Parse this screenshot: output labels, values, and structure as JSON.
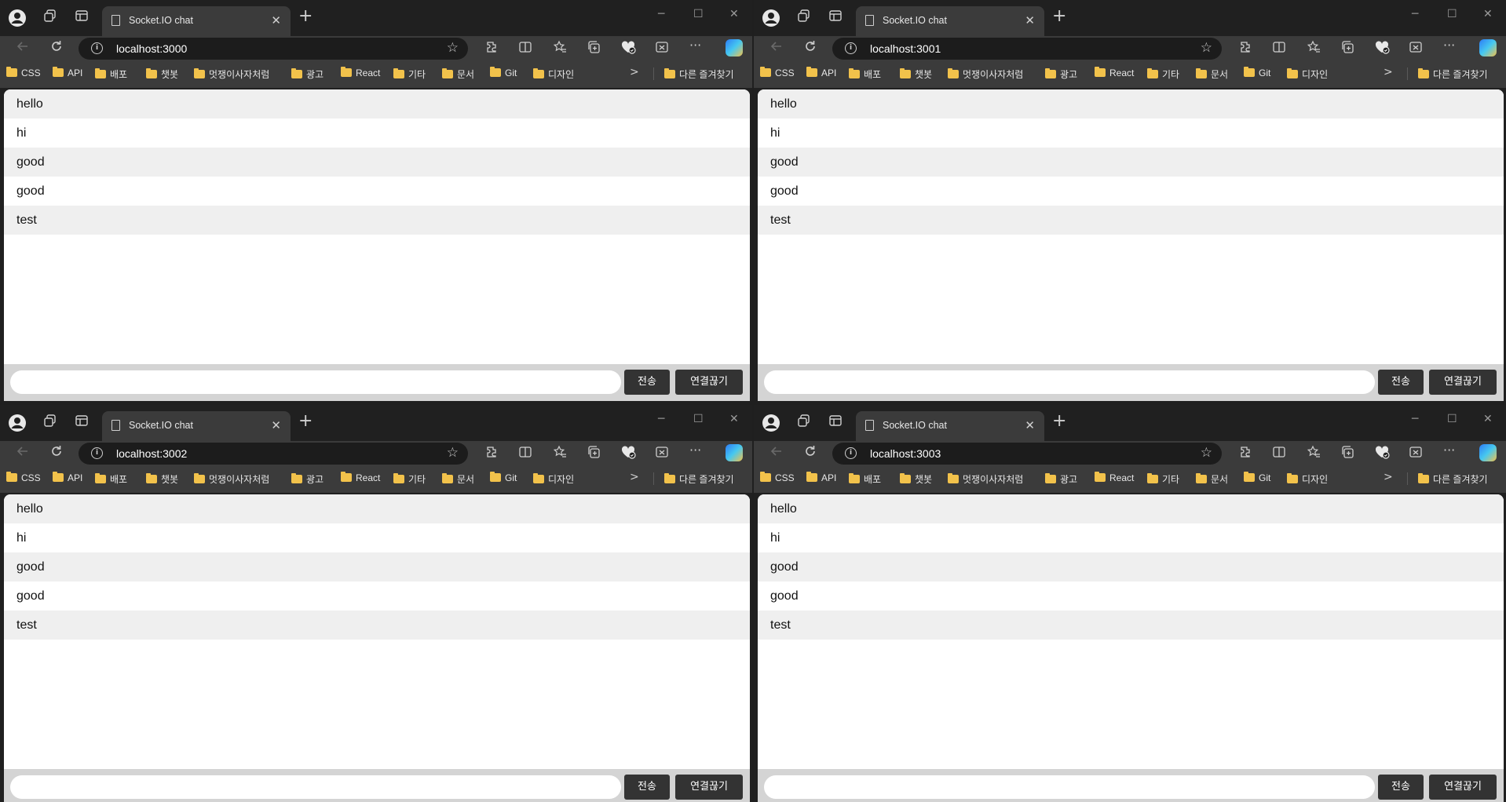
{
  "browser": {
    "tab_title": "Socket.IO chat",
    "new_tab_glyph": "+",
    "close_glyph": "✕",
    "minimize_glyph": "─",
    "maximize_glyph": "☐",
    "bookmarks": [
      "CSS",
      "API",
      "배포",
      "챗봇",
      "멋쟁이사자처럼",
      "광고",
      "React",
      "기타",
      "문서",
      "Git",
      "디자인"
    ],
    "other_favorites": "다른 즐겨찾기"
  },
  "windows": [
    {
      "url": "localhost:3000"
    },
    {
      "url": "localhost:3001"
    },
    {
      "url": "localhost:3002"
    },
    {
      "url": "localhost:3003"
    }
  ],
  "chat": {
    "messages": [
      "hello",
      "hi",
      "good",
      "good",
      "test"
    ],
    "input_value": "",
    "send_label": "전송",
    "disconnect_label": "연결끊기"
  },
  "icons": {
    "back": "back-arrow-icon",
    "refresh": "refresh-icon",
    "info": "site-info-icon",
    "favorite": "favorite-star-icon",
    "extensions": "extensions-icon",
    "split": "split-screen-icon",
    "favorites": "favorites-icon",
    "collections": "collections-icon",
    "health": "browser-essentials-icon",
    "screenshot": "screenshot-icon",
    "more": "more-icon",
    "copilot": "copilot-icon"
  },
  "colors": {
    "browser_dark": "#202020",
    "toolbar": "#3b3b3b",
    "stripe": "#efefef",
    "form_bar": "#d4d4d4",
    "button": "#333333",
    "folder": "#f2c24b"
  }
}
